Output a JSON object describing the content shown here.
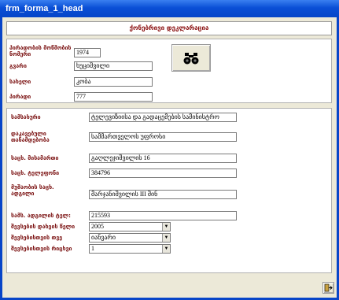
{
  "window": {
    "title": "frm_forma_1_head"
  },
  "form": {
    "header": "ქონებრივი დეკლარაცია"
  },
  "person": {
    "id_label": "პირადობის მოწმობის ნომერი",
    "id_value": "1974",
    "surname_label": "გვარი",
    "surname_value": "ხუციშვილი",
    "name_label": "სახელი",
    "name_value": "კობა",
    "code_label": "პირადი",
    "code_value": "777"
  },
  "org": {
    "org_label": "სამსახური",
    "org_value": "ტელევიზიისა და გადაცემების სამინისტრო",
    "position_label": "დაკავებული თანამდებობა",
    "position_value": "სამმართველოს უფროსი",
    "address_label": "საცხ. მისამართი",
    "address_value": "გაღლეჯიშვილის 16",
    "phone_label": "საცხ. ტელეფონი",
    "phone_value": "384796",
    "workplace_label": "მუშაობის საცხ. ადგილი",
    "workplace_value": "მარჯანიშვილის III შინ",
    "workphone_label": "სამს. ადგილის ტელ:",
    "workphone_value": "215593",
    "year_label": "შევსების დახვის წელი",
    "year_value": "2005",
    "month_label": "შევსებისთვის თვე",
    "month_value": "იანვარი",
    "day_label": "შევსებისთვის რიცხვი",
    "day_value": "1"
  },
  "icons": {
    "search": "binoculars-icon",
    "exit": "exit-door-icon"
  }
}
